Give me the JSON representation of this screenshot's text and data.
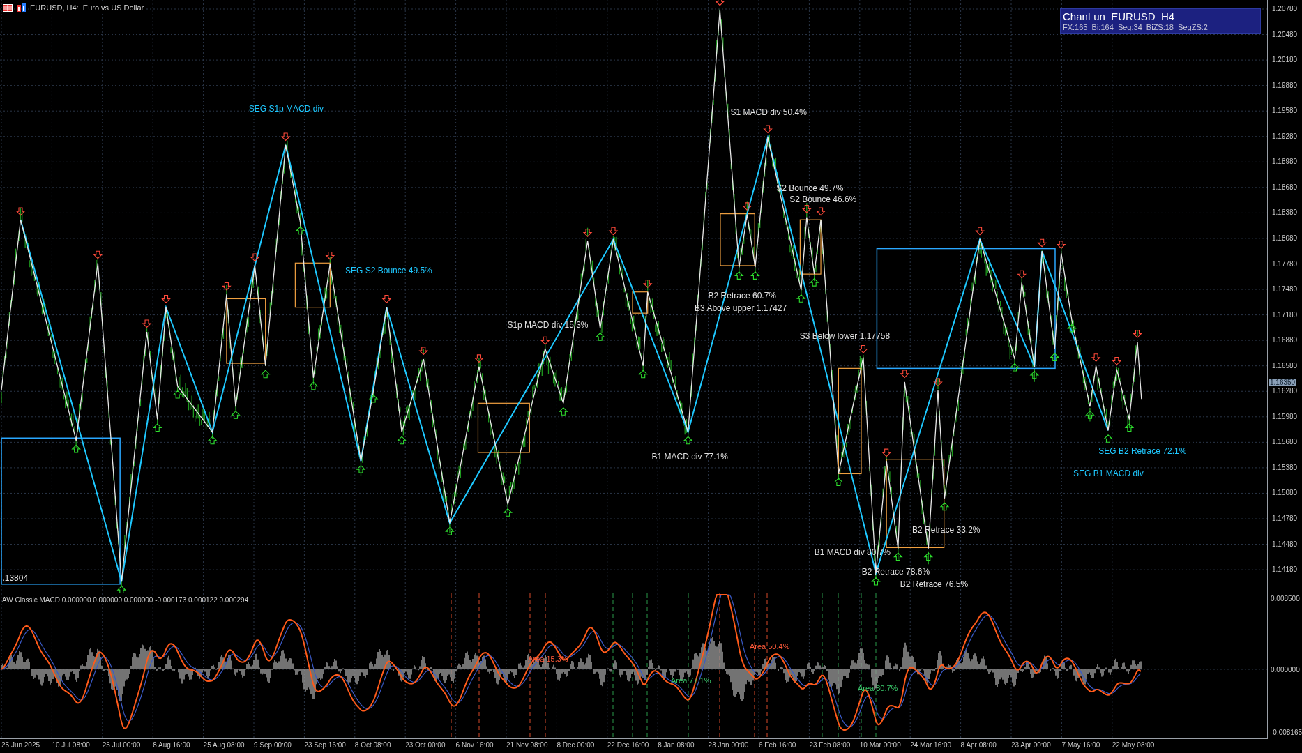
{
  "header": {
    "title": "EURUSD, H4:  Euro vs US Dollar"
  },
  "info_box": {
    "title": "ChanLun  EURUSD  H4",
    "stats": "FX:165  Bi:164  Seg:34  BiZS:18  SegZS:2"
  },
  "current_price": "1.16350",
  "price_axis": [
    "1.20780",
    "1.20480",
    "1.20180",
    "1.19880",
    "1.19580",
    "1.19280",
    "1.18980",
    "1.18680",
    "1.18380",
    "1.18080",
    "1.17780",
    "1.17480",
    "1.17180",
    "1.16880",
    "1.16580",
    "1.16280",
    "1.15980",
    "1.15680",
    "1.15380",
    "1.15080",
    "1.14780",
    "1.14480",
    "1.14180"
  ],
  "time_axis": [
    "25 Jun 2025",
    "10 Jul 08:00",
    "25 Jul 00:00",
    "8 Aug 16:00",
    "25 Aug 08:00",
    "9 Sep 00:00",
    "23 Sep 16:00",
    "8 Oct 08:00",
    "23 Oct 00:00",
    "6 Nov 16:00",
    "21 Nov 08:00",
    "8 Dec 00:00",
    "22 Dec 16:00",
    "8 Jan 08:00",
    "23 Jan 00:00",
    "6 Feb 16:00",
    "23 Feb 08:00",
    "10 Mar 00:00",
    "24 Mar 16:00",
    "8 Apr 08:00",
    "23 Apr 00:00",
    "7 May 16:00",
    "22 May 08:00"
  ],
  "signals": [
    {
      "kind": "seg",
      "text": "SEG S1p MACD div"
    },
    {
      "kind": "seg",
      "text": "SEG S2 Bounce 49.5%"
    },
    {
      "kind": "bi",
      "text": "S1p MACD div 15.3%"
    },
    {
      "kind": "bi",
      "text": "S1 MACD div 50.4%"
    },
    {
      "kind": "bi",
      "text": "S2 Bounce 49.7%"
    },
    {
      "kind": "bi",
      "text": "S2 Bounce 46.6%"
    },
    {
      "kind": "bi",
      "text": "B2 Retrace 60.7%"
    },
    {
      "kind": "bi",
      "text": "B3 Above upper 1.17427"
    },
    {
      "kind": "bi",
      "text": "S3 Below lower 1.17758"
    },
    {
      "kind": "bi",
      "text": "B1 MACD div 77.1%"
    },
    {
      "kind": "bi",
      "text": "B2 Retrace 33.2%"
    },
    {
      "kind": "bi",
      "text": "B1 MACD div 80.7%"
    },
    {
      "kind": "bi",
      "text": "B2 Retrace 78.6%"
    },
    {
      "kind": "bi",
      "text": "B2 Retrace 76.5%"
    },
    {
      "kind": "seg",
      "text": "SEG B2 Retrace 72.1%"
    },
    {
      "kind": "seg",
      "text": "SEG B1 MACD div"
    },
    {
      "kind": "bi",
      "text": ".13804"
    }
  ],
  "macd": {
    "title": "AW Classic MACD 0.000000 0.000000 0.000000 -0.000173 0.000122 0.000294",
    "axis_labels": [
      "0.008500",
      "0.000000",
      "-0.008165"
    ],
    "areas": [
      {
        "kind": "top",
        "text": "Area 15.3%"
      },
      {
        "kind": "top",
        "text": "Area 50.4%"
      },
      {
        "kind": "bottom",
        "text": "Area 77.1%"
      },
      {
        "kind": "bottom",
        "text": "Area 80.7%"
      }
    ]
  }
}
